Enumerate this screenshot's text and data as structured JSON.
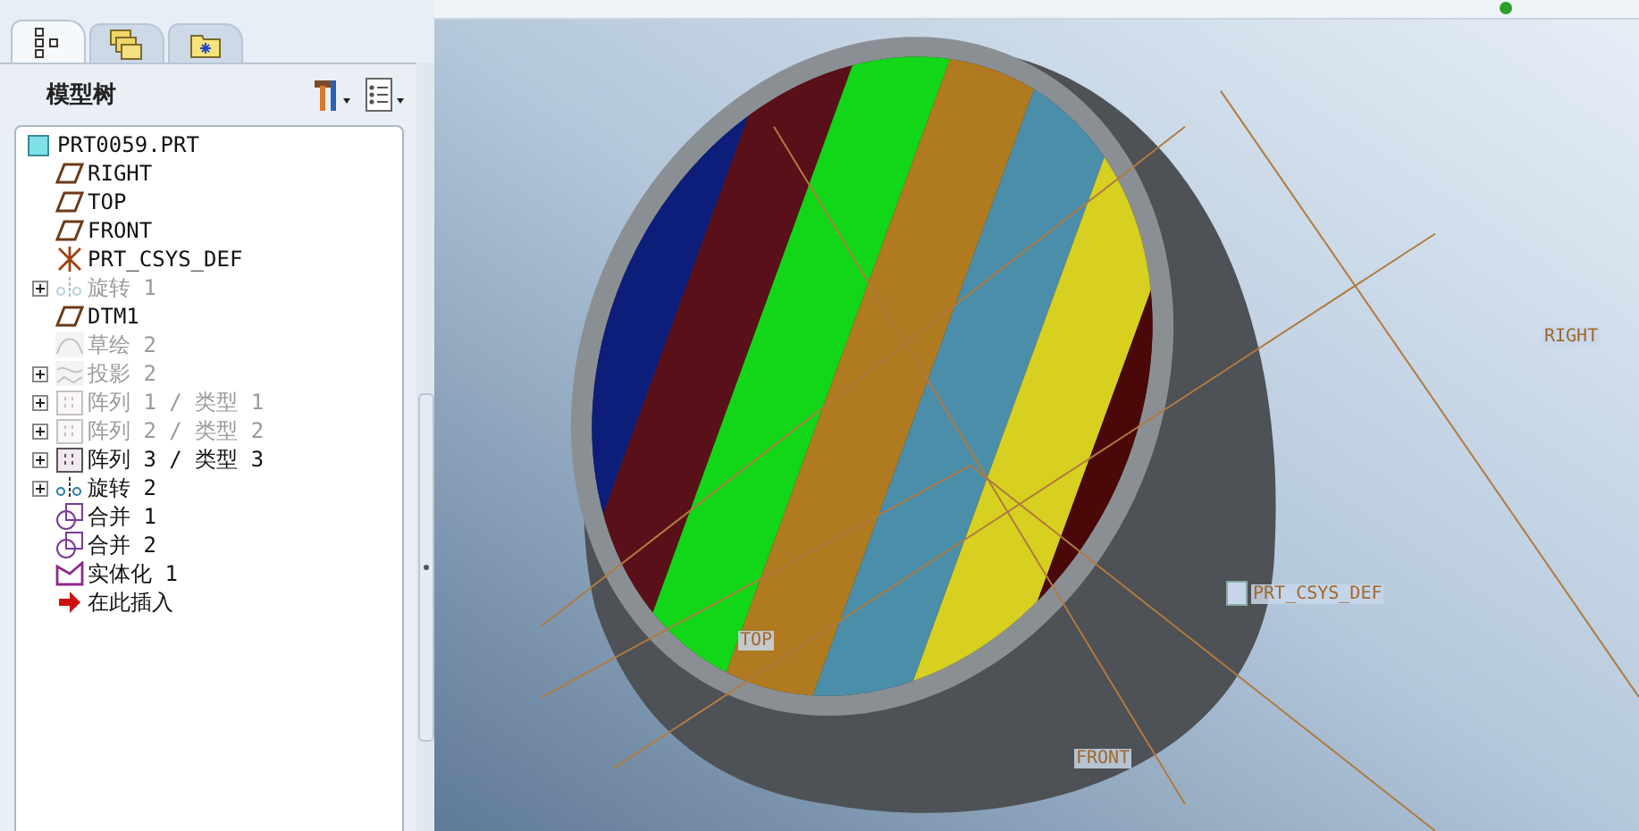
{
  "navigator_tabs": [
    {
      "kind": "tree",
      "selected": true
    },
    {
      "kind": "folders",
      "selected": false
    },
    {
      "kind": "favorites",
      "selected": false
    }
  ],
  "model_tree": {
    "title": "模型树",
    "root": {
      "label": "PRT0059.PRT",
      "kind": "part",
      "children": [
        {
          "label": "RIGHT",
          "kind": "plane",
          "disabled": false,
          "collapsed": false
        },
        {
          "label": "TOP",
          "kind": "plane",
          "disabled": false,
          "collapsed": false
        },
        {
          "label": "FRONT",
          "kind": "plane",
          "disabled": false,
          "collapsed": false
        },
        {
          "label": "PRT_CSYS_DEF",
          "kind": "csys",
          "disabled": false,
          "collapsed": false
        },
        {
          "label": "旋转 1",
          "kind": "revolve",
          "disabled": true,
          "collapsed": true
        },
        {
          "label": "DTM1",
          "kind": "plane",
          "disabled": false,
          "collapsed": false
        },
        {
          "label": "草绘 2",
          "kind": "sketch",
          "disabled": true,
          "collapsed": false
        },
        {
          "label": "投影 2",
          "kind": "projection",
          "disabled": true,
          "collapsed": true
        },
        {
          "label": "阵列 1 / 类型 1",
          "kind": "pattern",
          "disabled": true,
          "collapsed": true
        },
        {
          "label": "阵列 2 / 类型 2",
          "kind": "pattern",
          "disabled": true,
          "collapsed": true
        },
        {
          "label": "阵列 3 / 类型 3",
          "kind": "pattern",
          "disabled": false,
          "collapsed": true
        },
        {
          "label": "旋转 2",
          "kind": "revolve",
          "disabled": false,
          "collapsed": true
        },
        {
          "label": "合并 1",
          "kind": "merge",
          "disabled": false,
          "collapsed": false
        },
        {
          "label": "合并 2",
          "kind": "merge",
          "disabled": false,
          "collapsed": false
        },
        {
          "label": "实体化 1",
          "kind": "solidify",
          "disabled": false,
          "collapsed": false
        },
        {
          "label": "在此插入",
          "kind": "insert",
          "disabled": false,
          "collapsed": false
        }
      ]
    }
  },
  "viewport": {
    "datum_labels": [
      {
        "label": "RIGHT",
        "kind": "plane"
      },
      {
        "label": "PRT_CSYS_DEF",
        "kind": "csys"
      },
      {
        "label": "TOP",
        "kind": "plane"
      },
      {
        "label": "FRONT",
        "kind": "plane"
      }
    ]
  }
}
